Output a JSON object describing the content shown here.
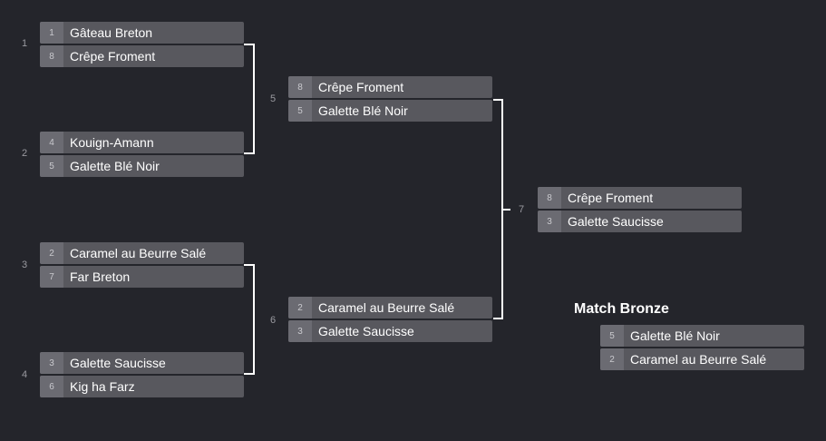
{
  "rounds": {
    "round1": [
      {
        "number": "1",
        "teams": [
          {
            "seed": "1",
            "name": "Gâteau Breton"
          },
          {
            "seed": "8",
            "name": "Crêpe Froment"
          }
        ]
      },
      {
        "number": "2",
        "teams": [
          {
            "seed": "4",
            "name": "Kouign-Amann"
          },
          {
            "seed": "5",
            "name": "Galette Blé Noir"
          }
        ]
      },
      {
        "number": "3",
        "teams": [
          {
            "seed": "2",
            "name": "Caramel au Beurre Salé"
          },
          {
            "seed": "7",
            "name": "Far Breton"
          }
        ]
      },
      {
        "number": "4",
        "teams": [
          {
            "seed": "3",
            "name": "Galette Saucisse"
          },
          {
            "seed": "6",
            "name": "Kig ha Farz"
          }
        ]
      }
    ],
    "round2": [
      {
        "number": "5",
        "teams": [
          {
            "seed": "8",
            "name": "Crêpe Froment"
          },
          {
            "seed": "5",
            "name": "Galette Blé Noir"
          }
        ]
      },
      {
        "number": "6",
        "teams": [
          {
            "seed": "2",
            "name": "Caramel au Beurre Salé"
          },
          {
            "seed": "3",
            "name": "Galette Saucisse"
          }
        ]
      }
    ],
    "final": {
      "number": "7",
      "teams": [
        {
          "seed": "8",
          "name": "Crêpe Froment"
        },
        {
          "seed": "3",
          "name": "Galette Saucisse"
        }
      ]
    }
  },
  "bronze": {
    "title": "Match Bronze",
    "teams": [
      {
        "seed": "5",
        "name": "Galette Blé Noir"
      },
      {
        "seed": "2",
        "name": "Caramel au Beurre Salé"
      }
    ]
  },
  "colors": {
    "background": "#24252b",
    "slot": "#58585e",
    "seed_cell": "#6b6b72",
    "connector": "#ffffff"
  }
}
